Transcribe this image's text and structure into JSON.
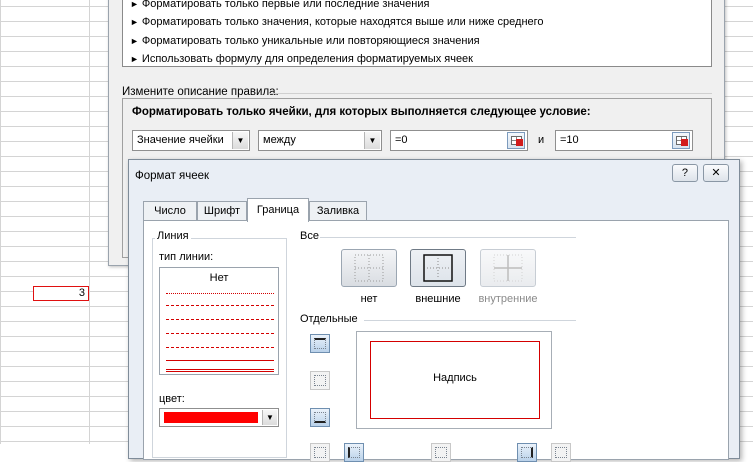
{
  "sheet": {
    "cell_value": "3"
  },
  "rule_dialog": {
    "rule_types": [
      "Форматировать только первые или последние значения",
      "Форматировать только значения, которые находятся выше или ниже среднего",
      "Форматировать только уникальные или повторяющиеся значения",
      "Использовать формулу для определения форматируемых ячеек"
    ],
    "edit_label": "Измените описание правила:",
    "condition_title": "Форматировать только ячейки, для которых выполняется следующее условие:",
    "field_combo": "Значение ячейки",
    "operator_combo": "между",
    "value1": "=0",
    "and_label": "и",
    "value2": "=10"
  },
  "format_dialog": {
    "title": "Формат ячеек",
    "help_button": "?",
    "close_button": "✕",
    "tabs": [
      "Число",
      "Шрифт",
      "Граница",
      "Заливка"
    ],
    "active_tab": "Граница",
    "line_group": "Линия",
    "line_type_label": "тип линии:",
    "line_none": "Нет",
    "color_label": "цвет:",
    "color_value": "#ff0000",
    "all_group": "Все",
    "presets": [
      "нет",
      "внешние",
      "внутренние"
    ],
    "separate_group": "Отдельные",
    "preview_caption": "Надпись",
    "accent_color": "#d40000"
  }
}
